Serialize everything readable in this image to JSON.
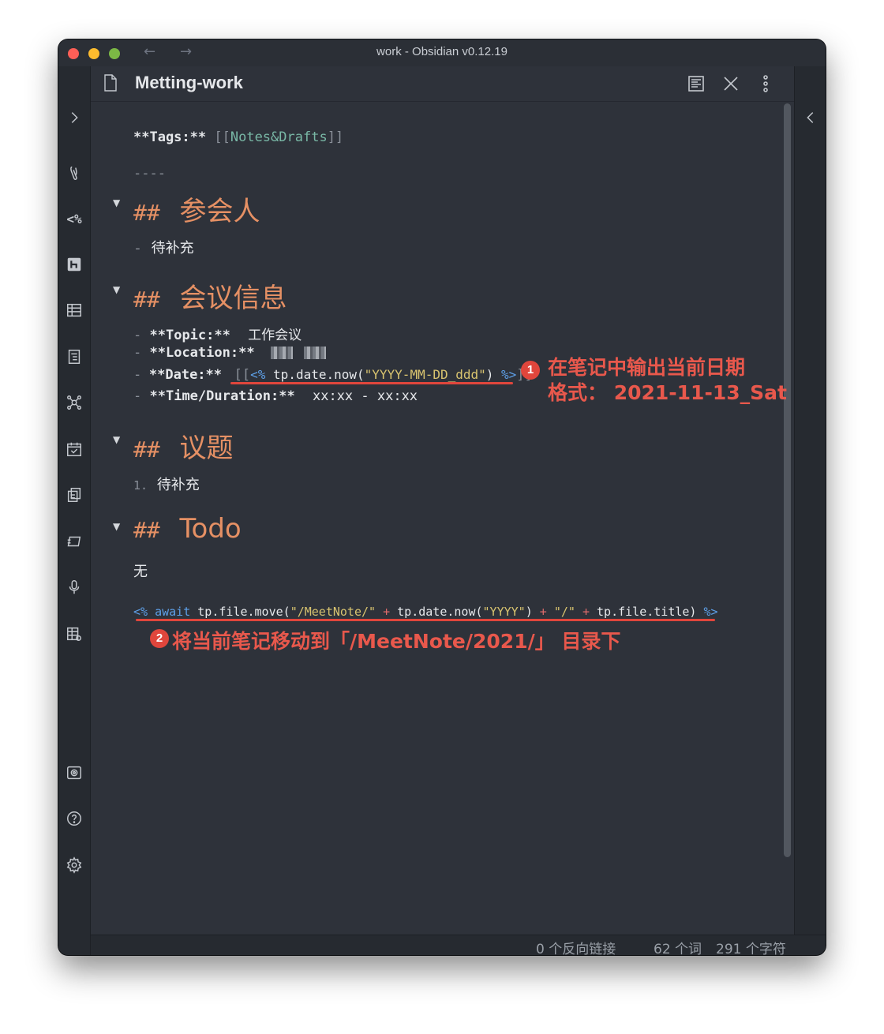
{
  "window": {
    "title": "work - Obsidian v0.12.19"
  },
  "nav": {
    "back": "←",
    "forward": "→"
  },
  "ribbon": {
    "expand_glyph": "›",
    "collapse_right_glyph": "‹",
    "templater_label": "<%",
    "icons": [
      "sidebar-expand-icon",
      "paperclip-icon",
      "templater-icon",
      "h-icon",
      "table-icon",
      "outline-icon",
      "graph-icon",
      "calendar-icon",
      "copy-icon",
      "slides-icon",
      "microphone-icon",
      "table-settings-icon",
      "vault-icon",
      "help-icon",
      "settings-icon"
    ]
  },
  "tab": {
    "title": "Metting-work",
    "actions": [
      "reading-view-icon",
      "close-icon",
      "more-options-icon"
    ]
  },
  "content": {
    "tags_label": "**Tags:**",
    "tags_link_open": "[[",
    "tags_link_text": "Notes&Drafts",
    "tags_link_close": "]]",
    "hr": "----",
    "h2_prefix": "##",
    "section1_title": "参会人",
    "section1_item": "待补充",
    "section2_title": "会议信息",
    "topic_label": "**Topic:**",
    "topic_value": "工作会议",
    "location_label": "**Location:**",
    "date_label": "**Date:**",
    "date_open": "[[",
    "date_tpl_open": "<%",
    "date_code": " tp.date.now(",
    "date_str": "\"YYYY-MM-DD_ddd\"",
    "date_code_close": ") ",
    "date_tpl_close": "%>",
    "date_close": "]]",
    "time_label": "**Time/Duration:**",
    "time_value": "xx:xx - xx:xx",
    "section3_title": "议题",
    "section3_num": "1.",
    "section3_item": "待补充",
    "section4_title": "Todo",
    "section4_text": "无",
    "move_tpl_open": "<%",
    "move_await": "await",
    "move_code1": " tp.file.move(",
    "move_str1": "\"/MeetNote/\"",
    "move_plus1": "+",
    "move_code2": "tp.date.now(",
    "move_str2": "\"YYYY\"",
    "move_code3": ")",
    "move_plus2": "+",
    "move_str3": "\"/\"",
    "move_plus3": "+",
    "move_code4": "tp.file.title)",
    "move_tpl_close": "%>",
    "bullet": "-"
  },
  "annotations": {
    "badge1": "1",
    "anno1_line1": "在笔记中输出当前日期",
    "anno1_line2": "格式： 2021-11-13_Sat",
    "badge2": "2",
    "anno2": "将当前笔记移动到「/MeetNote/2021/」 目录下",
    "color": "#e0463c"
  },
  "status": {
    "backlinks": "0 个反向链接",
    "words": "62 个词",
    "chars": "291 个字符"
  },
  "colors": {
    "bg": "#2e323a",
    "heading": "#e59064",
    "link": "#79b8a6",
    "templater": "#5ea0e8",
    "string": "#d8c36f"
  }
}
